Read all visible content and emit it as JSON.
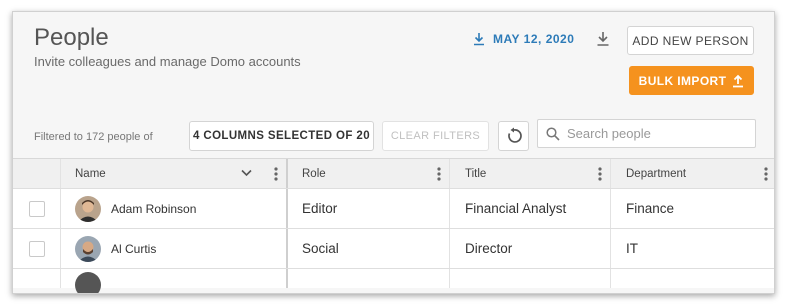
{
  "header": {
    "title": "People",
    "subtitle": "Invite colleagues and manage Domo accounts",
    "date_link": "MAY 12, 2020",
    "add_button": "ADD NEW PERSON",
    "bulk_button": "BULK IMPORT"
  },
  "toolbar": {
    "filter_text": "Filtered to 172 people of",
    "columns_button": "4 COLUMNS SELECTED OF 20",
    "clear_button": "CLEAR FILTERS",
    "search_placeholder": "Search people"
  },
  "table": {
    "columns": [
      "Name",
      "Role",
      "Title",
      "Department"
    ],
    "rows": [
      {
        "name": "Adam Robinson",
        "role": "Editor",
        "title": "Financial Analyst",
        "department": "Finance"
      },
      {
        "name": "Al Curtis",
        "role": "Social",
        "title": "Director",
        "department": "IT"
      }
    ]
  },
  "colors": {
    "accent": "#f5921e",
    "link": "#2d7bb8"
  },
  "icons": [
    "download-icon",
    "upload-icon",
    "reset-icon",
    "search-icon",
    "kebab-icon",
    "chevron-down-icon"
  ]
}
